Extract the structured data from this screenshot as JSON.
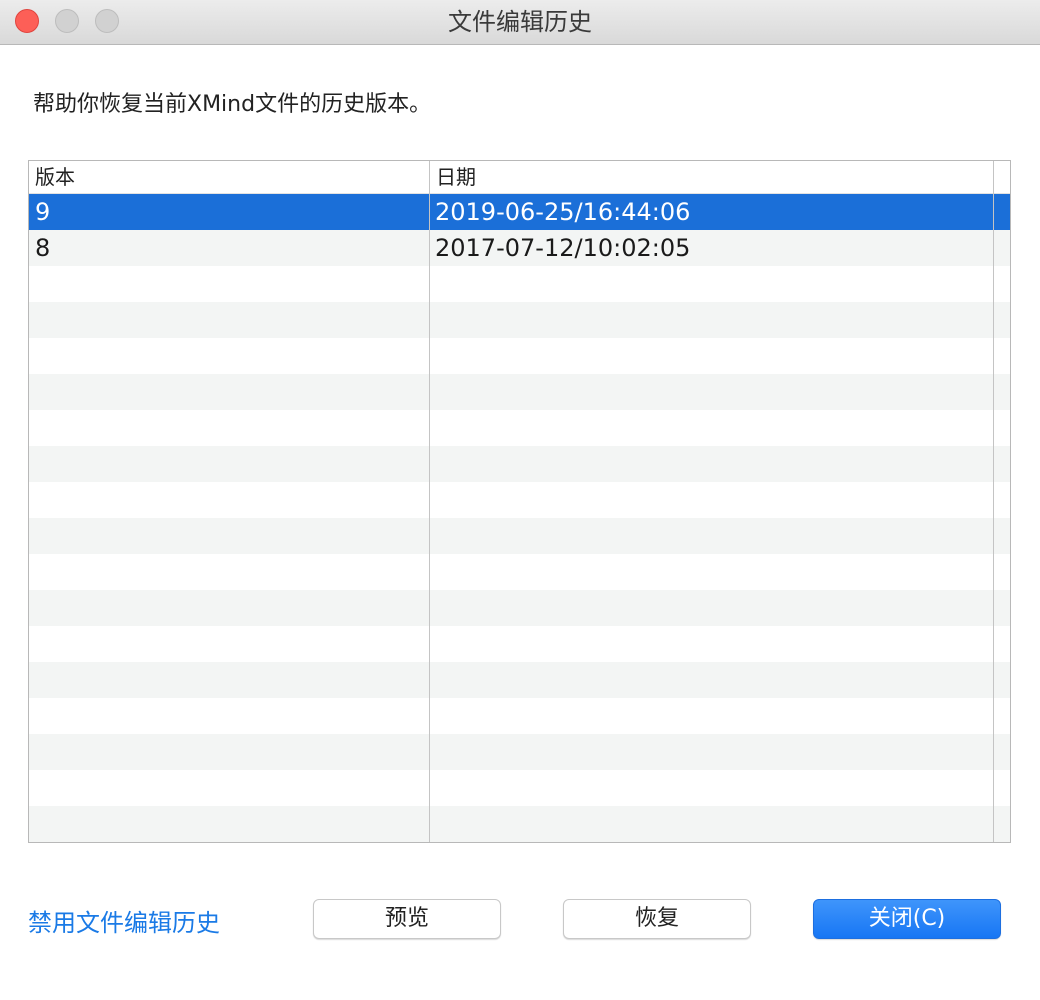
{
  "window": {
    "title": "文件编辑历史"
  },
  "description": "帮助你恢复当前XMind文件的历史版本。",
  "table": {
    "columns": {
      "version": "版本",
      "date": "日期"
    },
    "rows": [
      {
        "version": "9",
        "date": "2019-06-25/16:44:06",
        "selected": true
      },
      {
        "version": "8",
        "date": "2017-07-12/10:02:05",
        "selected": false
      }
    ],
    "empty_rows": 16
  },
  "footer": {
    "disable_link": "禁用文件编辑历史",
    "preview_label": "预览",
    "restore_label": "恢复",
    "close_label": "关闭(C)"
  },
  "colors": {
    "accent": "#1b6fd8",
    "link": "#1a7ae6"
  }
}
